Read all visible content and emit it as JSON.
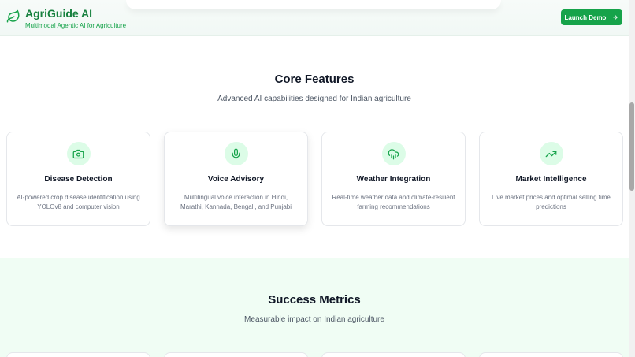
{
  "brand": {
    "title": "AgriGuide AI",
    "subtitle": "Multimodal Agentic AI for Agriculture",
    "logo_icon": "leaf-icon"
  },
  "header": {
    "launch_label": "Launch Demo",
    "launch_icon": "arrow-right-icon"
  },
  "features": {
    "title": "Core Features",
    "subtitle": "Advanced AI capabilities designed for Indian agriculture",
    "cards": [
      {
        "icon": "camera-icon",
        "title": "Disease Detection",
        "description": "AI-powered crop disease identification using YOLOv8 and computer vision"
      },
      {
        "icon": "microphone-icon",
        "title": "Voice Advisory",
        "description": "Multilingual voice interaction in Hindi, Marathi, Kannada, Bengali, and Punjabi"
      },
      {
        "icon": "cloud-rain-icon",
        "title": "Weather Integration",
        "description": "Real-time weather data and climate-resilient farming recommendations"
      },
      {
        "icon": "trending-up-icon",
        "title": "Market Intelligence",
        "description": "Live market prices and optimal selling time predictions"
      }
    ]
  },
  "metrics": {
    "title": "Success Metrics",
    "subtitle": "Measurable impact on Indian agriculture"
  },
  "colors": {
    "brand_green": "#16a34a",
    "brand_dark_green": "#15803d",
    "icon_bg": "#dcfce7",
    "metrics_bg": "#f0fdf4"
  }
}
